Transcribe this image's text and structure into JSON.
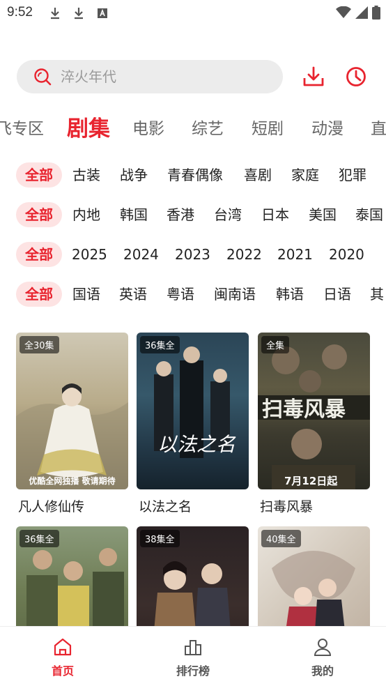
{
  "status_bar": {
    "time": "9:52"
  },
  "search": {
    "placeholder": "淬火年代"
  },
  "channels": [
    "飞专区",
    "剧集",
    "电影",
    "综艺",
    "短剧",
    "动漫",
    "直"
  ],
  "filters": {
    "genre": [
      "全部",
      "古装",
      "战争",
      "青春偶像",
      "喜剧",
      "家庭",
      "犯罪"
    ],
    "region": [
      "全部",
      "内地",
      "韩国",
      "香港",
      "台湾",
      "日本",
      "美国",
      "泰国"
    ],
    "year": [
      "全部",
      "2025",
      "2024",
      "2023",
      "2022",
      "2021",
      "2020"
    ],
    "language": [
      "全部",
      "国语",
      "英语",
      "粤语",
      "闽南语",
      "韩语",
      "日语",
      "其"
    ]
  },
  "shows": [
    {
      "title": "凡人修仙传",
      "badge": "全30集",
      "caption": "优酷全网独播 敬请期待"
    },
    {
      "title": "以法之名",
      "badge": "36集全",
      "caption": ""
    },
    {
      "title": "扫毒风暴",
      "badge": "全集",
      "caption": "7月12日起"
    },
    {
      "title": "",
      "badge": "36集全",
      "caption": ""
    },
    {
      "title": "",
      "badge": "38集全",
      "caption": ""
    },
    {
      "title": "",
      "badge": "40集全",
      "caption": ""
    }
  ],
  "bottom_nav": [
    {
      "label": "首页",
      "icon": "home-icon",
      "active": true
    },
    {
      "label": "排行榜",
      "icon": "bar-chart-icon",
      "active": false
    },
    {
      "label": "我的",
      "icon": "user-icon",
      "active": false
    }
  ],
  "colors": {
    "accent": "#e8242f",
    "chip_bg": "#fde3e3",
    "search_bg": "#ececec"
  }
}
